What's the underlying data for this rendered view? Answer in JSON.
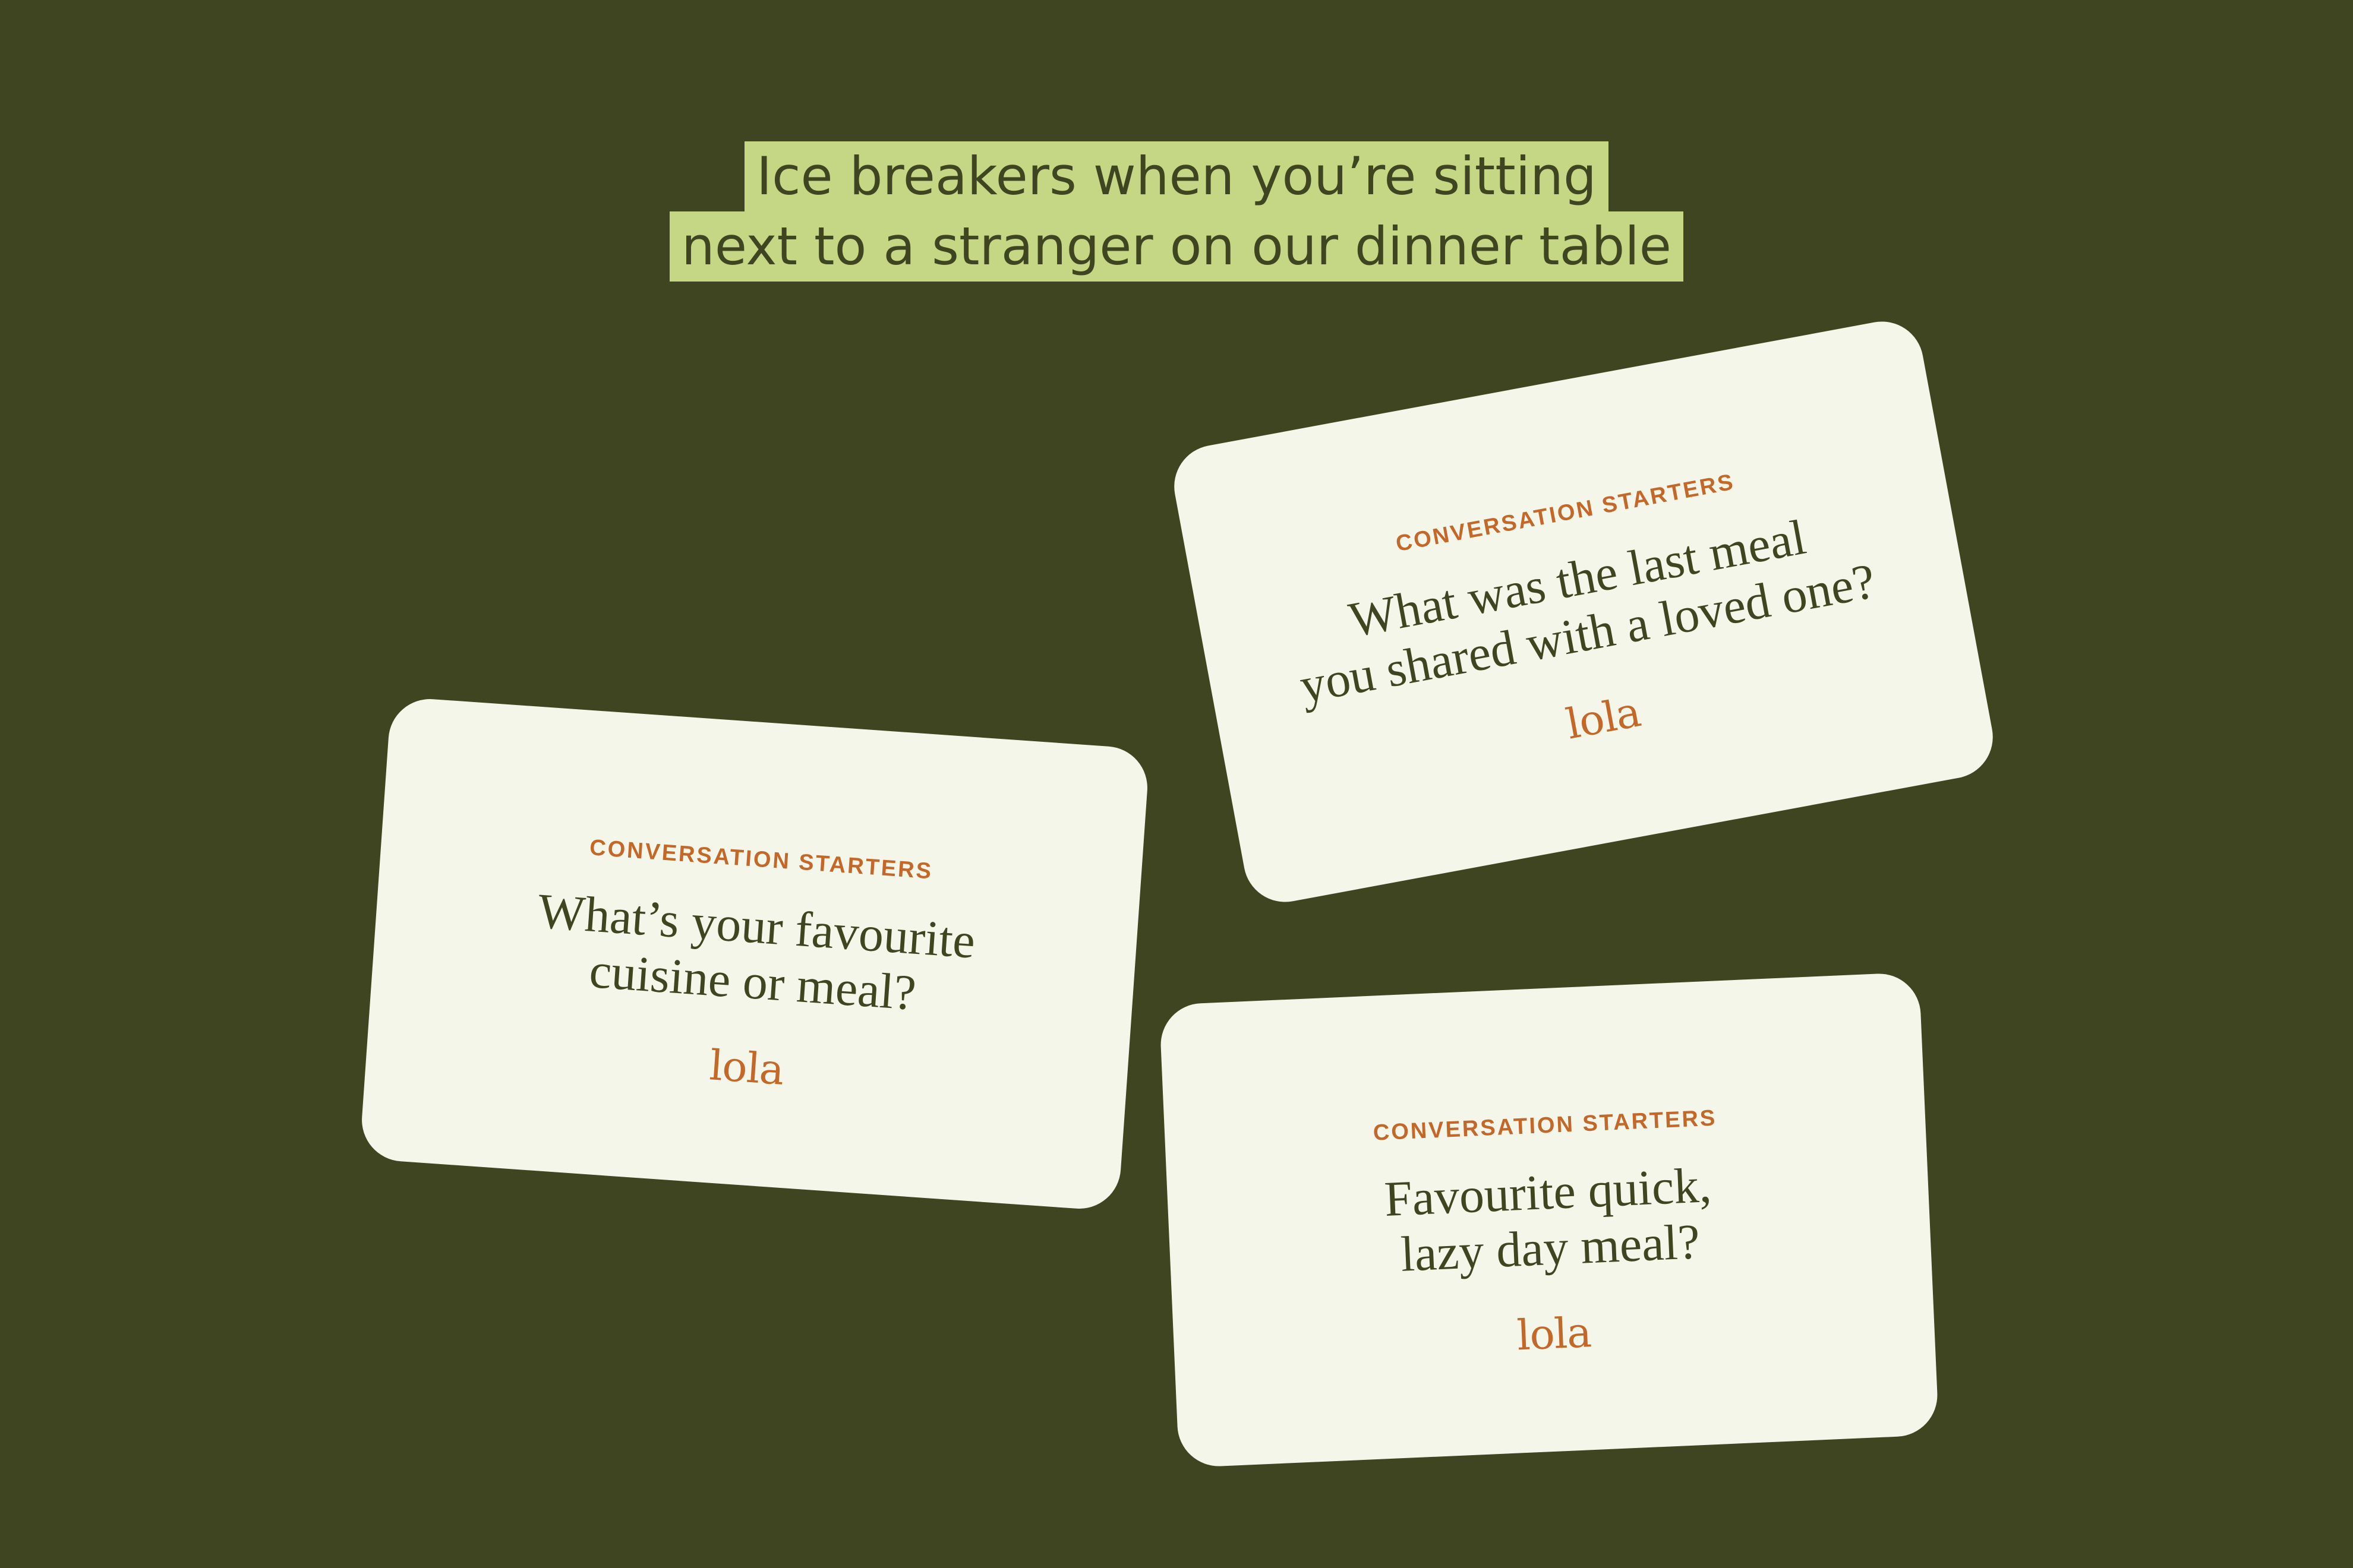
{
  "headline": {
    "line1": "Ice breakers when you’re sitting",
    "line2": "next to a stranger on our dinner table"
  },
  "cards": [
    {
      "kicker": "CONVERSATION STARTERS",
      "question_line1": "What’s your favourite",
      "question_line2": "cuisine or meal?",
      "logo": "lola"
    },
    {
      "kicker": "CONVERSATION STARTERS",
      "question_line1": "What was the last meal",
      "question_line2": "you shared with a loved one?",
      "logo": "lola"
    },
    {
      "kicker": "CONVERSATION STARTERS",
      "question_line1": "Favourite quick,",
      "question_line2": "lazy day meal?",
      "logo": "lola"
    }
  ],
  "colors": {
    "background": "#3e4520",
    "highlight": "#c5d685",
    "card": "#f4f6ea",
    "accent": "#c4682a",
    "text": "#3e4520"
  }
}
